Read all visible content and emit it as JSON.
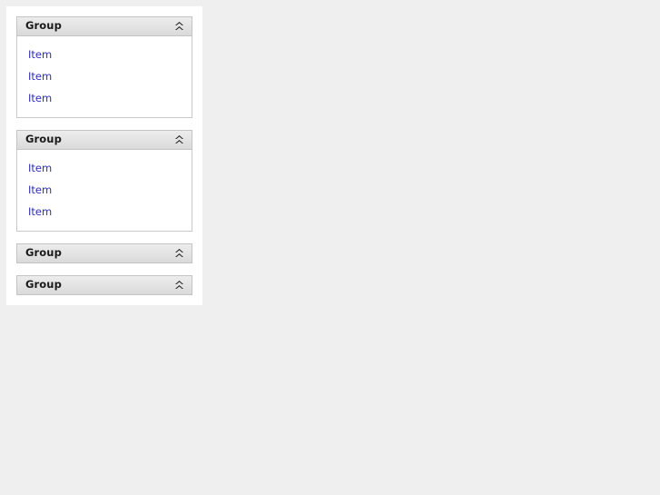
{
  "page": {
    "background_color": "#efefef",
    "panel_background": "#ffffff"
  },
  "panel": {
    "name": "collapsible-group-panel",
    "accent_link_color": "#2f2fb3",
    "header_background": "#e3e3e3",
    "header_border_color": "#c4c4c4",
    "groups": [
      {
        "title": "Group",
        "expanded": true,
        "collapse_icon": "double-chevron-up-icon",
        "items": [
          {
            "label": "Item"
          },
          {
            "label": "Item"
          },
          {
            "label": "Item"
          }
        ]
      },
      {
        "title": "Group",
        "expanded": true,
        "collapse_icon": "double-chevron-up-icon",
        "items": [
          {
            "label": "Item"
          },
          {
            "label": "Item"
          },
          {
            "label": "Item"
          }
        ]
      },
      {
        "title": "Group",
        "expanded": false,
        "collapse_icon": "double-chevron-up-icon",
        "items": []
      },
      {
        "title": "Group",
        "expanded": false,
        "collapse_icon": "double-chevron-up-icon",
        "items": []
      }
    ]
  }
}
